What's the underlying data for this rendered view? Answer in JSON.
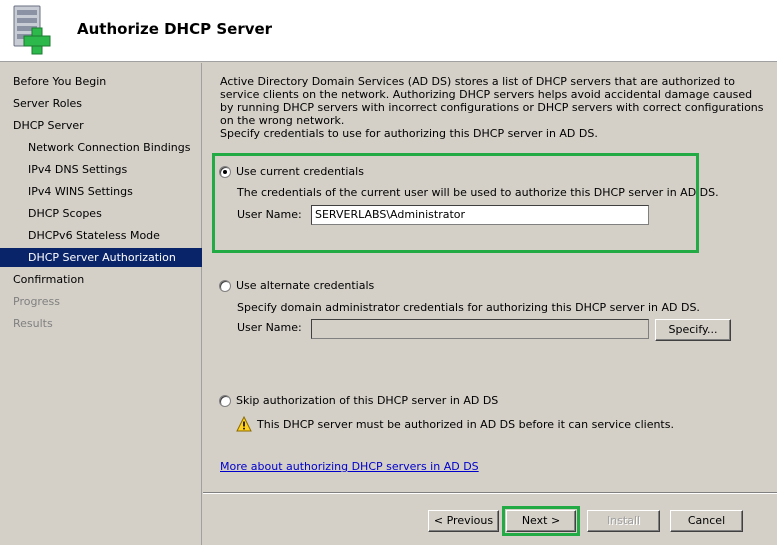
{
  "header": {
    "title": "Authorize DHCP Server"
  },
  "nav": {
    "items": [
      {
        "label": "Before You Begin"
      },
      {
        "label": "Server Roles"
      },
      {
        "label": "DHCP Server"
      },
      {
        "label": "Network Connection Bindings"
      },
      {
        "label": "IPv4 DNS Settings"
      },
      {
        "label": "IPv4 WINS Settings"
      },
      {
        "label": "DHCP Scopes"
      },
      {
        "label": "DHCPv6 Stateless Mode"
      },
      {
        "label": "DHCP Server Authorization"
      },
      {
        "label": "Confirmation"
      },
      {
        "label": "Progress"
      },
      {
        "label": "Results"
      }
    ]
  },
  "main": {
    "description": "Active Directory Domain Services (AD DS) stores a list of DHCP servers that are authorized to service clients on the network. Authorizing DHCP servers helps avoid accidental damage caused by running DHCP servers with incorrect configurations or DHCP servers with correct configurations on the wrong network.",
    "specify": "Specify credentials to use for authorizing this DHCP server in AD DS.",
    "option_current": {
      "label": "Use current credentials",
      "info": "The credentials of the current user will be used to authorize this DHCP server in AD DS.",
      "username_label": "User Name:",
      "username_value": "SERVERLABS\\Administrator"
    },
    "option_alternate": {
      "label": "Use alternate credentials",
      "info": "Specify domain administrator credentials for authorizing this DHCP server in AD DS.",
      "username_label": "User Name:",
      "username_value": "",
      "specify_button": "Specify..."
    },
    "option_skip": {
      "label": "Skip authorization of this DHCP server in AD DS",
      "warning": "This DHCP server must be authorized in AD DS before it can service clients."
    },
    "link": "More about authorizing DHCP servers in AD DS"
  },
  "footer": {
    "previous": "< Previous",
    "next": "Next >",
    "install": "Install",
    "cancel": "Cancel"
  },
  "colors": {
    "highlight": "#22aa44",
    "selected_nav": "#0a246a",
    "link": "#0000cc"
  },
  "icons": {
    "header": "server-add-icon",
    "warning": "warning-icon"
  }
}
